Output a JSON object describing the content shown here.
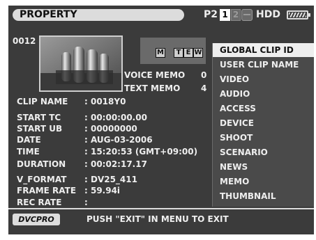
{
  "header": {
    "title": "PROPERTY",
    "media_label": "P2",
    "slot1": "1",
    "slot2": "2",
    "hdd_label": "HDD",
    "battery_icon": "battery-icon",
    "hdd_icon": "hdd-icon"
  },
  "clip": {
    "number": "0012",
    "flags": {
      "m": "M",
      "t": "T",
      "e": "E",
      "w": "W"
    },
    "voice_memo_label": "VOICE MEMO",
    "voice_memo_count": "0",
    "text_memo_label": "TEXT MEMO",
    "text_memo_count": "4"
  },
  "fields": [
    {
      "label": "CLIP NAME",
      "value": ": 0018Y0"
    },
    {
      "label": "START TC",
      "value": ": 00:00:00.00"
    },
    {
      "label": "START UB",
      "value": ": 00000000"
    },
    {
      "label": "DATE",
      "value": ": AUG-03-2006"
    },
    {
      "label": "TIME",
      "value": ": 15:20:53 (GMT+09:00)"
    },
    {
      "label": "DURATION",
      "value": ": 00:02:17.17"
    },
    {
      "label": "V_FORMAT",
      "value": ": DV25_411"
    },
    {
      "label": "FRAME RATE",
      "value": ": 59.94i"
    },
    {
      "label": "REC RATE",
      "value": ":"
    }
  ],
  "menu": {
    "items": [
      "GLOBAL CLIP ID",
      "USER CLIP NAME",
      "VIDEO",
      "AUDIO",
      "ACCESS",
      "DEVICE",
      "SHOOT",
      "SCENARIO",
      "NEWS",
      "MEMO",
      "THUMBNAIL"
    ],
    "selected_index": 0
  },
  "footer": {
    "format_badge": "DVCPRO",
    "message": "PUSH \"EXIT\" IN MENU TO EXIT"
  },
  "colors": {
    "background": "#3b3b3b",
    "menu_background": "#4a4a4a",
    "selected": "#eeeeee",
    "text": "#eeeeee"
  }
}
